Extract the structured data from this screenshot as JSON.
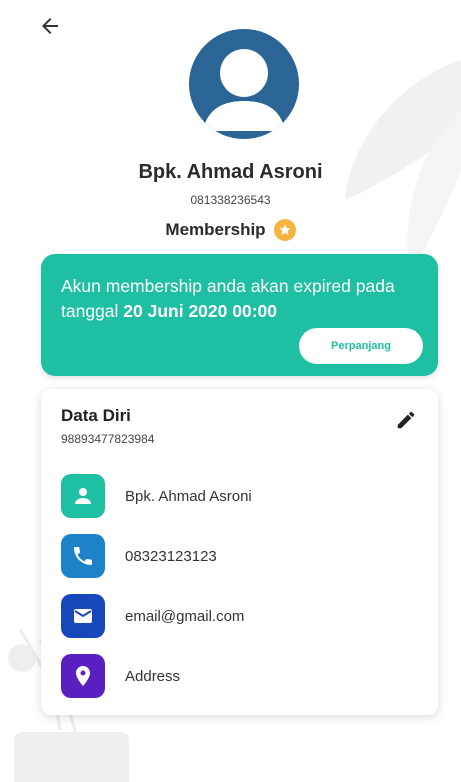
{
  "header": {
    "back_icon": "arrow-left-icon"
  },
  "profile": {
    "avatar_icon": "user-avatar-icon",
    "name": "Bpk. Ahmad Asroni",
    "phone": "081338236543",
    "membership_label": "Membership",
    "membership_badge_icon": "star-icon"
  },
  "banner": {
    "text_prefix": "Akun membership anda akan expired pada tanggal ",
    "expiry_date": "20 Juni 2020 00:00",
    "renew_button": "Perpanjang"
  },
  "data_diri": {
    "title": "Data Diri",
    "id_number": "98893477823984",
    "edit_icon": "pencil-icon",
    "rows": [
      {
        "icon": "person-icon",
        "color": "#1ebfa2",
        "value": "Bpk. Ahmad Asroni"
      },
      {
        "icon": "phone-icon",
        "color": "#1e82c8",
        "value": "08323123123"
      },
      {
        "icon": "mail-icon",
        "color": "#1747b8",
        "value": "email@gmail.com"
      },
      {
        "icon": "location-pin-icon",
        "color": "#5a1fc0",
        "value": "Address"
      }
    ]
  },
  "colors": {
    "accent_teal": "#1ebfa2",
    "avatar_blue": "#2b6596",
    "badge_gold": "#f5b43d"
  }
}
